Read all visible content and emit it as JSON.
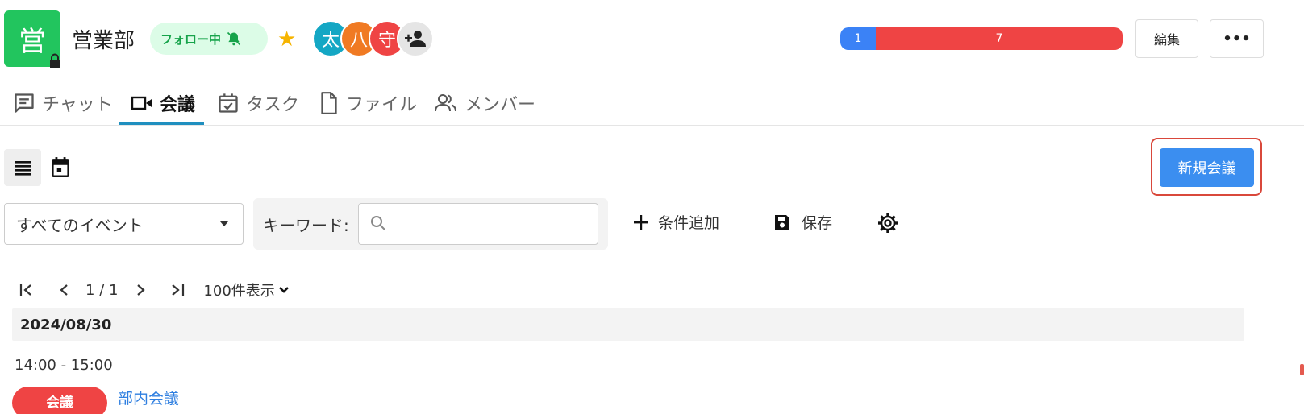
{
  "team": {
    "avatar_char": "営",
    "name": "営業部",
    "follow_label": "フォロー中"
  },
  "members": [
    {
      "char": "太",
      "color": "#14a7c4"
    },
    {
      "char": "八",
      "color": "#f07a23"
    },
    {
      "char": "守",
      "color": "#ef4444"
    }
  ],
  "progress": {
    "left_value": "1",
    "right_value": "7",
    "left_color": "#3b82f6",
    "right_color": "#ef4444"
  },
  "actions": {
    "edit_label": "編集",
    "more_label": "•••"
  },
  "tabs": [
    {
      "label": "チャット",
      "icon": "chat-icon"
    },
    {
      "label": "会議",
      "icon": "video-icon",
      "active": true
    },
    {
      "label": "タスク",
      "icon": "task-calendar-icon"
    },
    {
      "label": "ファイル",
      "icon": "file-icon"
    },
    {
      "label": "メンバー",
      "icon": "members-icon"
    }
  ],
  "toolbar": {
    "new_meeting_label": "新規会議"
  },
  "filters": {
    "event_select_value": "すべてのイベント",
    "keyword_label": "キーワード:",
    "keyword_value": "",
    "add_condition_label": "条件追加",
    "save_label": "保存"
  },
  "pager": {
    "page_info": "1 / 1",
    "page_size_label": "100件表示"
  },
  "events": {
    "date": "2024/08/30",
    "time_range": "14:00  -  15:00",
    "type_badge": "会議",
    "title": "部内会議",
    "badge_color": "#ef4444"
  }
}
